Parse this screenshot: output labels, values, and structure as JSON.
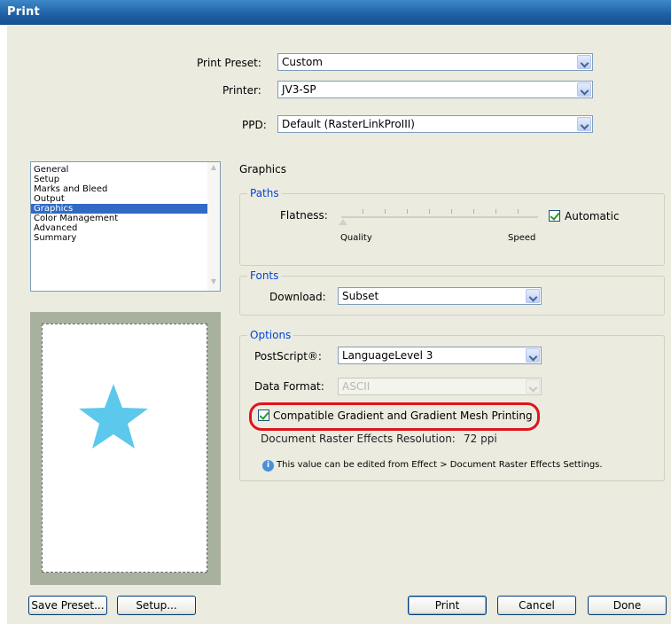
{
  "window": {
    "title": "Print"
  },
  "header": {
    "preset_label": "Print Preset:",
    "preset_value": "Custom",
    "printer_label": "Printer:",
    "printer_value": "JV3-SP",
    "ppd_label": "PPD:",
    "ppd_value": "Default (RasterLinkProIII)"
  },
  "sidebar": {
    "items": [
      {
        "label": "General"
      },
      {
        "label": "Setup"
      },
      {
        "label": "Marks and Bleed"
      },
      {
        "label": "Output"
      },
      {
        "label": "Graphics"
      },
      {
        "label": "Color Management"
      },
      {
        "label": "Advanced"
      },
      {
        "label": "Summary"
      }
    ],
    "selected": "Graphics"
  },
  "section_title": "Graphics",
  "paths": {
    "title": "Paths",
    "flatness_label": "Flatness:",
    "quality_label": "Quality",
    "speed_label": "Speed",
    "automatic_label": "Automatic",
    "automatic_checked": true
  },
  "fonts": {
    "title": "Fonts",
    "download_label": "Download:",
    "download_value": "Subset"
  },
  "options": {
    "title": "Options",
    "postscript_label": "PostScript®:",
    "postscript_value": "LanguageLevel 3",
    "data_format_label": "Data Format:",
    "data_format_value": "ASCII",
    "compatible_label": "Compatible Gradient and Gradient Mesh Printing",
    "compatible_checked": true,
    "raster_label": "Document Raster Effects Resolution:",
    "raster_value": "72  ppi",
    "info_text": "This value can be edited from Effect > Document Raster Effects Settings."
  },
  "buttons": {
    "save_preset": "Save Preset...",
    "setup": "Setup...",
    "print": "Print",
    "cancel": "Cancel",
    "done": "Done"
  },
  "colors": {
    "title_bar": "#1f5fa4",
    "dialog_bg": "#ecebe0",
    "selection": "#316ac5",
    "group_title": "#0046d5",
    "highlight_ring": "#e0141c",
    "star": "#5bc8ec"
  },
  "icons": [
    "chevron-down-icon",
    "checkmark-icon",
    "info-icon",
    "star-preview"
  ]
}
